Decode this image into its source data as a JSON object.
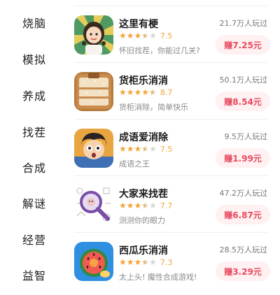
{
  "sidebar": {
    "categories": [
      "烧脑",
      "模拟",
      "养成",
      "找茬",
      "合成",
      "解谜",
      "经营",
      "益智"
    ]
  },
  "games": [
    {
      "title": "这里有梗",
      "rating": "7.5",
      "stars": 3.5,
      "desc": "怀旧找茬，你能过几关?",
      "played": "21.7万人玩过",
      "earn": "赚7.25元",
      "icon": "girl-portrait-icon"
    },
    {
      "title": "货柜乐消消",
      "rating": "8.7",
      "stars": 4.5,
      "desc": "货柜消除，简单快乐",
      "played": "50.1万人玩过",
      "earn": "赚8.54元",
      "icon": "wooden-shelf-icon"
    },
    {
      "title": "成语爱消除",
      "rating": "7.5",
      "stars": 3.5,
      "desc": "成语之王",
      "played": "9.5万人玩过",
      "earn": "赚1.99元",
      "icon": "surprised-boy-icon"
    },
    {
      "title": "大家来找茬",
      "rating": "7.7",
      "stars": 3.5,
      "desc": "测测你的眼力",
      "played": "47.2万人玩过",
      "earn": "赚6.87元",
      "icon": "magnifier-doodle-icon"
    },
    {
      "title": "西瓜乐消消",
      "rating": "7.3",
      "stars": 3.5,
      "desc": "太上头! 魔性合成游戏!",
      "played": "28.5万人玩过",
      "earn": "赚3.29元",
      "icon": "watermelon-icon"
    }
  ],
  "colors": {
    "star": "#f1a53a",
    "earn_text": "#e84a5f",
    "earn_bg": "#fff0f1"
  }
}
